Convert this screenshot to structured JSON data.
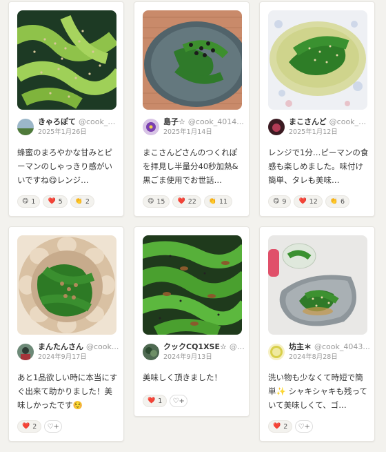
{
  "cards": [
    {
      "name": "きゃろぽて",
      "handle": "@cook_4...",
      "date": "2025年1月26日",
      "comment": "蜂蜜のまろやかな甘みとピーマンのしゃっきり感がいいですね😋レンジ…",
      "reactions": [
        {
          "emoji_icon": "smile-icon",
          "emoji": "😋",
          "count": "1"
        },
        {
          "emoji_icon": "heart-icon",
          "emoji": "❤️",
          "count": "5"
        },
        {
          "emoji_icon": "clap-icon",
          "emoji": "👏",
          "count": "2"
        }
      ]
    },
    {
      "name": "島子☆",
      "handle": "@cook_4014...",
      "date": "2025年1月14日",
      "comment": "まこさんどさんのつくれぽを拝見し半量分40秒加熱&黒ごま使用でお世話…",
      "reactions": [
        {
          "emoji_icon": "smile-icon",
          "emoji": "😋",
          "count": "15"
        },
        {
          "emoji_icon": "heart-icon",
          "emoji": "❤️",
          "count": "22"
        },
        {
          "emoji_icon": "clap-icon",
          "emoji": "👏",
          "count": "11"
        }
      ]
    },
    {
      "name": "まこさんど",
      "handle": "@cook_4...",
      "date": "2025年1月12日",
      "comment": "レンジで1分…ピーマンの食感も楽しめました。味付け簡単、タレも美味…",
      "reactions": [
        {
          "emoji_icon": "smile-icon",
          "emoji": "😋",
          "count": "9"
        },
        {
          "emoji_icon": "heart-icon",
          "emoji": "❤️",
          "count": "12"
        },
        {
          "emoji_icon": "clap-icon",
          "emoji": "👏",
          "count": "6"
        }
      ]
    },
    {
      "name": "まんたんさん",
      "handle": "@cook...",
      "date": "2024年9月17日",
      "comment": "あと1品欲しい時に本当にすぐ出来て助かりました！美味しかったです☺️",
      "reactions": [
        {
          "emoji_icon": "heart-icon",
          "emoji": "❤️",
          "count": "2"
        }
      ]
    },
    {
      "name": "クックCQ1XSE☆",
      "handle": "@c...",
      "date": "2024年9月13日",
      "comment": "美味しく頂きました！",
      "reactions": [
        {
          "emoji_icon": "heart-icon",
          "emoji": "❤️",
          "count": "1"
        }
      ]
    },
    {
      "name": "坊主＊",
      "handle": "@cook_4043...",
      "date": "2024年8月28日",
      "comment": "洗い物も少なくて時短で簡単✨ シャキシャキも残っていて美味しくて、ゴ…",
      "reactions": [
        {
          "emoji_icon": "heart-icon",
          "emoji": "❤️",
          "count": "2"
        }
      ]
    }
  ],
  "add_reaction_icon": "add-reaction-icon",
  "add_reaction_glyph": "♡+"
}
